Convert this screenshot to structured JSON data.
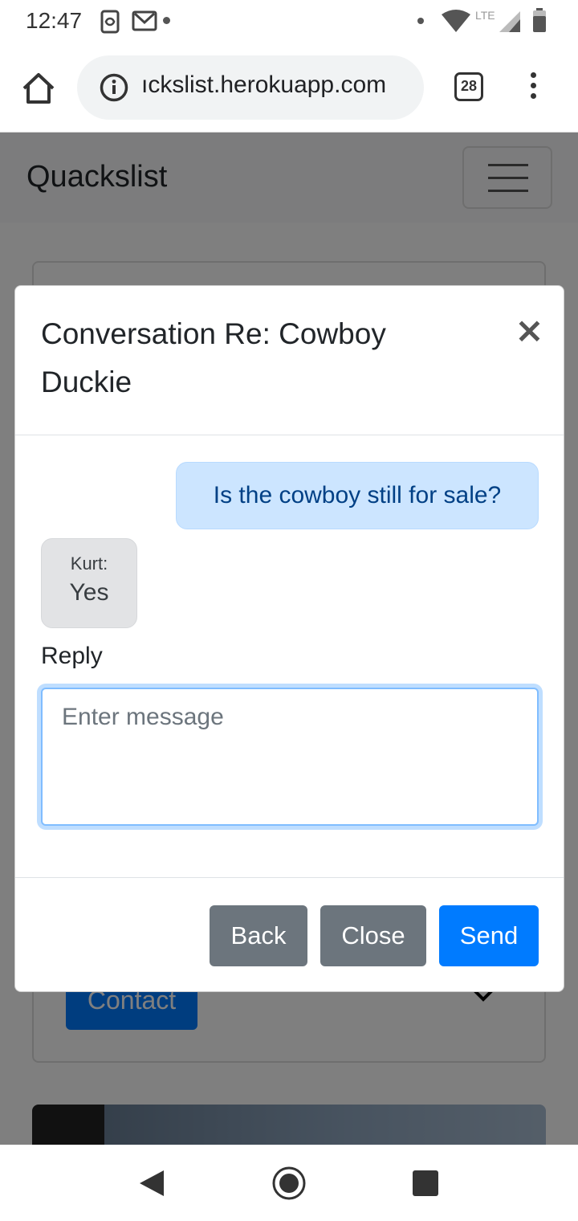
{
  "status_bar": {
    "time": "12:47",
    "network": "LTE"
  },
  "browser": {
    "url": "ıckslist.herokuapp.com",
    "tab_count": "28"
  },
  "page": {
    "brand": "Quackslist",
    "contact_label": "Contact"
  },
  "modal": {
    "title": "Conversation Re: Cowboy Duckie",
    "close_symbol": "×",
    "messages": [
      {
        "direction": "outgoing",
        "text": "Is the cowboy still for sale?"
      },
      {
        "direction": "incoming",
        "sender": "Kurt:",
        "text": "Yes"
      }
    ],
    "reply_label": "Reply",
    "reply_placeholder": "Enter message",
    "buttons": {
      "back": "Back",
      "close": "Close",
      "send": "Send"
    }
  },
  "colors": {
    "primary": "#007bff",
    "secondary": "#6c757d",
    "outgoing_bubble": "#cce5ff",
    "incoming_bubble": "#e2e3e5"
  }
}
